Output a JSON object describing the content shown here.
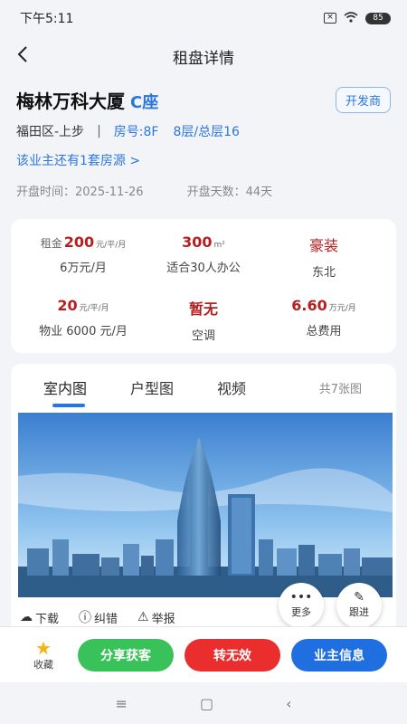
{
  "status": {
    "time": "下午5:11",
    "battery": "85"
  },
  "header": {
    "title": "租盘详情"
  },
  "property": {
    "name": "梅林万科大厦",
    "block": "C座",
    "developer_badge": "开发商",
    "district": "福田区-上步",
    "separator": "|",
    "room": "房号:8F",
    "floor": "8层/总层16",
    "owner_link": "该业主还有1套房源 >",
    "open_time": "开盘时间：2025-11-26",
    "open_days": "开盘天数：44天"
  },
  "stats": {
    "rent": {
      "prefix": "租金",
      "value": "200",
      "unit": "元/平/月",
      "sub": "6万元/月"
    },
    "area": {
      "value": "300",
      "unit": "m²",
      "sub": "适合30人办公"
    },
    "decor": {
      "value": "豪装",
      "sub": "东北"
    },
    "mgmt": {
      "value": "20",
      "unit": "元/平/月",
      "sub": "物业 6000 元/月"
    },
    "ac": {
      "value": "暂无",
      "sub": "空调"
    },
    "total": {
      "value": "6.60",
      "unit": "万元/月",
      "sub": "总费用"
    }
  },
  "media": {
    "tabs": [
      "室内图",
      "户型图",
      "视频"
    ],
    "photo_count": "共7张图",
    "actions": {
      "download": "下载",
      "correct": "纠错",
      "report": "举报"
    },
    "more": "更多",
    "follow": "跟进"
  },
  "bottom": {
    "fav": "收藏",
    "share": "分享获客",
    "invalid": "转无效",
    "owner": "业主信息"
  },
  "colors": {
    "accent": "#2a76e0",
    "price": "#b51f1f",
    "green": "#3ac25a",
    "red": "#ea2d2d",
    "blue": "#1f6fe0"
  }
}
